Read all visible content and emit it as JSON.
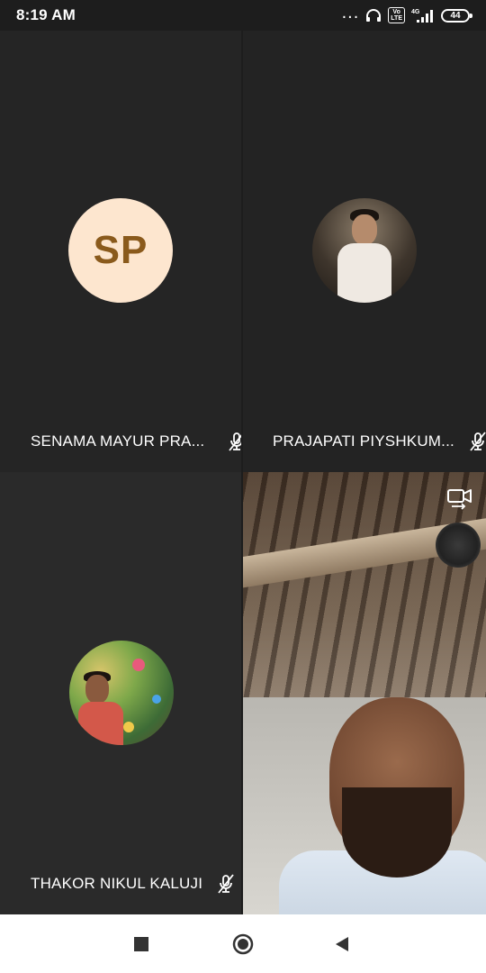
{
  "status_bar": {
    "time": "8:19 AM",
    "dots": "...",
    "volte": "Vo\nLTE",
    "network": "4G",
    "battery": "44",
    "icons": [
      "more-dots-icon",
      "headphones-icon",
      "volte-icon",
      "signal-icon",
      "battery-icon"
    ]
  },
  "participants": [
    {
      "name": "SENAMA MAYUR PRA...",
      "initials": "SP",
      "avatar_type": "initials",
      "avatar_bg": "#fde6cf",
      "avatar_fg": "#8a5a1c",
      "muted": true
    },
    {
      "name": "PRAJAPATI PIYSHKUM...",
      "avatar_type": "photo",
      "muted": true
    },
    {
      "name": "THAKOR NIKUL KALUJI",
      "avatar_type": "photo",
      "muted": true
    }
  ],
  "self_view": {
    "camera_switch_icon": "switch-camera-icon"
  },
  "nav_bar": {
    "buttons": [
      "recents-square-icon",
      "home-circle-icon",
      "back-triangle-icon"
    ]
  },
  "colors": {
    "tile_bg": "#262626",
    "text": "#ffffff",
    "nav_bg": "#ffffff",
    "nav_icon": "#333333"
  }
}
